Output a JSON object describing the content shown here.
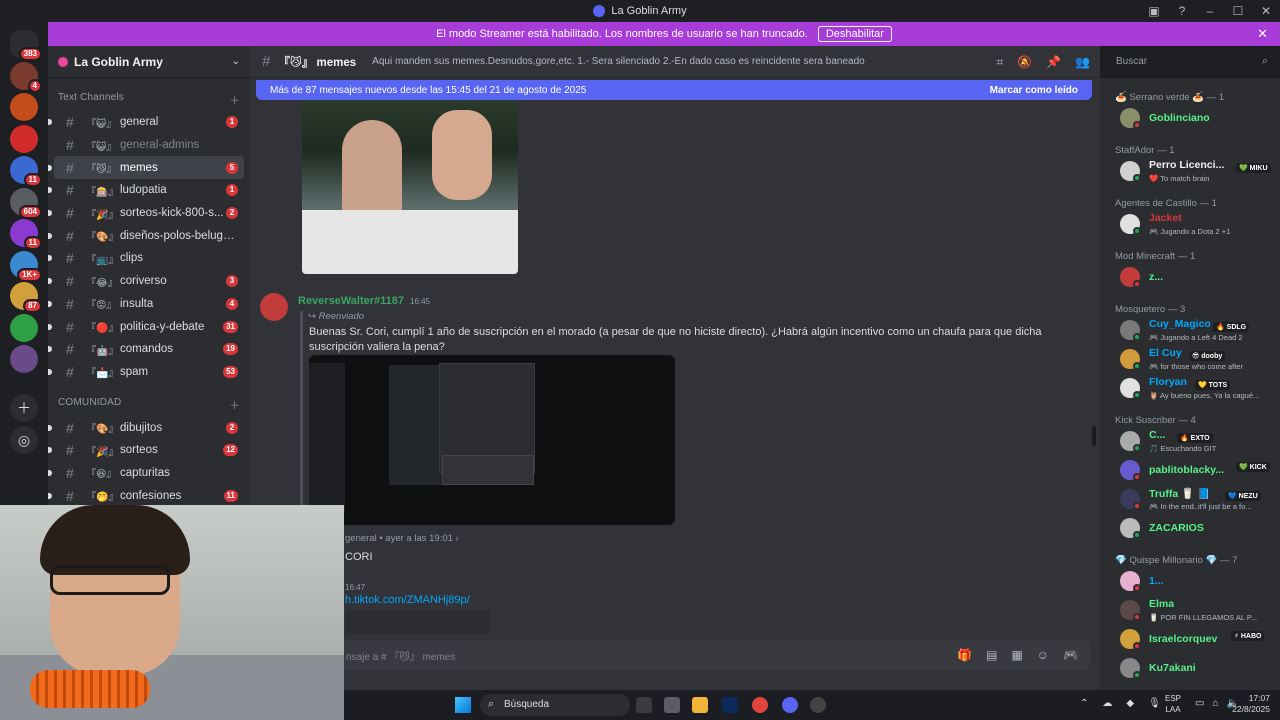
{
  "window": {
    "title": "La Goblin Army"
  },
  "banner": {
    "text": "El modo Streamer está habilitado. Los nombres de usuario se han truncado.",
    "button": "Deshabilitar"
  },
  "servers": [
    {
      "badge": "383",
      "color": "#2b2d31"
    },
    {
      "badge": "4",
      "color": "#7a3b2e"
    },
    {
      "badge": "",
      "color": "#c44b1b"
    },
    {
      "badge": "",
      "color": "#d12b2b"
    },
    {
      "badge": "11",
      "color": "#3a6ad1"
    },
    {
      "badge": "604",
      "color": "#5a5d63"
    },
    {
      "badge": "11",
      "color": "#8a3ad1"
    },
    {
      "badge": "1K+",
      "color": "#3a8ad1"
    },
    {
      "badge": "87",
      "color": "#d1a03a"
    },
    {
      "badge": "",
      "color": "#2ea043"
    },
    {
      "badge": "",
      "color": "#6a4a8a"
    }
  ],
  "guild": {
    "name": "La Goblin Army"
  },
  "categories": {
    "text": "Text Channels",
    "community": "COMUNIDAD"
  },
  "channels": [
    {
      "deco": "『😺』",
      "name": "general",
      "count": "1",
      "state": ""
    },
    {
      "deco": "『😺』",
      "name": "general-admins",
      "count": "",
      "state": "muted"
    },
    {
      "deco": "『😼』",
      "name": "memes",
      "count": "5",
      "state": "active"
    },
    {
      "deco": "『🎰』",
      "name": "ludopatia",
      "count": "1",
      "state": ""
    },
    {
      "deco": "『🎉』",
      "name": "sorteos-kick-800-s...",
      "count": "2",
      "state": ""
    },
    {
      "deco": "『🎨』",
      "name": "diseños-polos-beluga-ar...",
      "count": "",
      "state": ""
    },
    {
      "deco": "『📺』",
      "name": "clips",
      "count": "",
      "state": ""
    },
    {
      "deco": "『😂』",
      "name": "coriverso",
      "count": "3",
      "state": ""
    },
    {
      "deco": "『😡』",
      "name": "insulta",
      "count": "4",
      "state": ""
    },
    {
      "deco": "『🔴』",
      "name": "politica-y-debate",
      "count": "31",
      "state": ""
    },
    {
      "deco": "『🤖』",
      "name": "comandos",
      "count": "19",
      "state": ""
    },
    {
      "deco": "『📩』",
      "name": "spam",
      "count": "53",
      "state": ""
    }
  ],
  "community_channels": [
    {
      "deco": "『🎨』",
      "name": "dibujitos",
      "count": "2"
    },
    {
      "deco": "『🎉』",
      "name": "sorteos",
      "count": "12"
    },
    {
      "deco": "『😆』",
      "name": "capturitas",
      "count": ""
    },
    {
      "deco": "『🤭』",
      "name": "confesiones",
      "count": "11"
    }
  ],
  "header": {
    "channel": "『😼』 memes",
    "topic": "Aqui manden sus memes.Desnudos,gore,etc. 1.- Sera silenciado 2.-En dado caso es reincidente sera baneado",
    "search_placeholder": "Buscar"
  },
  "new_bar": {
    "text": "Más de 87 mensajes nuevos desde las 15:45 del 21 de agosto de 2025",
    "action": "Marcar como leído"
  },
  "message": {
    "author": "ReverseWalter#1187",
    "time": "16:45",
    "forwarded": "Reenviado",
    "text": "Buenas Sr. Cori, cumplí 1 año de suscripción en el morado (a pesar de que no hiciste directo). ¿Habrá algún incentivo como un chaufa para que dicha suscripción valiera la pena?",
    "source_meta": "general  •  ayer a las 19:01  ›"
  },
  "message2": {
    "text": "CORI",
    "time": "16:47",
    "link": "h.tiktok.com/ZMANHj89p/"
  },
  "composer": {
    "placeholder": "nsaje a # 『😼』 memes"
  },
  "members": {
    "groups": [
      {
        "title": "🍝 Serrano verde 🍝 — 1",
        "members": [
          {
            "name": "Goblinciano",
            "color": "#57f287",
            "tag": "",
            "activity": "",
            "status": "#da373c",
            "avatar": "#8a8f6a"
          }
        ]
      },
      {
        "title": "StaffAdor — 1",
        "members": [
          {
            "name": "Perro Licenci...",
            "color": "#f2f3f5",
            "tag": "💚 MIKU",
            "activity": "❤️ To match brain",
            "status": "#23a55a",
            "avatar": "#d0d0d0"
          }
        ]
      },
      {
        "title": "Agentes de Castillo — 1",
        "members": [
          {
            "name": "Jacket",
            "color": "#da373c",
            "tag": "",
            "activity": "🎮 Jugando a Dota 2 +1",
            "status": "#23a55a",
            "avatar": "#e0e0e0"
          }
        ]
      },
      {
        "title": "Mod Minecraft — 1",
        "members": [
          {
            "name": "z...",
            "color": "#57f287",
            "tag": "",
            "activity": "",
            "status": "#da373c",
            "avatar": "#c23c3c"
          }
        ]
      },
      {
        "title": "Mosquetero — 3",
        "members": [
          {
            "name": "Cuy_Magico",
            "color": "#00a8fc",
            "tag": "🔥 SDLG",
            "activity": "🎮 Jugando a Left 4 Dead 2",
            "status": "#23a55a",
            "avatar": "#7a7a7a"
          },
          {
            "name": "El Cuy",
            "color": "#00a8fc",
            "tag": "😎 dooby",
            "activity": "🎮 for those who come after",
            "status": "#23a55a",
            "avatar": "#d19a3a"
          },
          {
            "name": "Floryan",
            "color": "#00a8fc",
            "tag": "💛 TOTS",
            "activity": "🦉 Ay bueno pues, Ya la cagué...",
            "status": "#23a55a",
            "avatar": "#e0e0e0"
          }
        ]
      },
      {
        "title": "Kick Suscriber — 4",
        "members": [
          {
            "name": "C...",
            "color": "#57f287",
            "tag": "🔥 EXTO",
            "activity": "🎵 Escuchando GIT",
            "status": "#23a55a",
            "avatar": "#aaaaaa"
          },
          {
            "name": "pablitoblacky...",
            "color": "#57f287",
            "tag": "💚 KICK",
            "activity": "",
            "status": "#da373c",
            "avatar": "#6a5ad1"
          },
          {
            "name": "Truffa 🥛 📘",
            "color": "#57f287",
            "tag": "💙 NEZU",
            "activity": "🎮 In the end..it'll just be a fo...",
            "status": "#da373c",
            "avatar": "#3a3a5a"
          },
          {
            "name": "ZACARIOS",
            "color": "#57f287",
            "tag": "",
            "activity": "",
            "status": "#23a55a",
            "avatar": "#bbbbbb"
          }
        ]
      },
      {
        "title": "💎 Quispe Millonario 💎 — 7",
        "members": [
          {
            "name": "1...",
            "color": "#00a8fc",
            "tag": "",
            "activity": "",
            "status": "#da373c",
            "avatar": "#e8b0d0"
          },
          {
            "name": "Elma",
            "color": "#57f287",
            "tag": "",
            "activity": "🥛 POR FIN LLEGAMOS AL P...",
            "status": "#da373c",
            "avatar": "#5a4a4a"
          },
          {
            "name": "Israelcorquev",
            "color": "#57f287",
            "tag": "⚡ HABO",
            "activity": "",
            "status": "#da373c",
            "avatar": "#d1a03a"
          },
          {
            "name": "Ku7akani",
            "color": "#57f287",
            "tag": "",
            "activity": "",
            "status": "#23a55a",
            "avatar": "#888888"
          }
        ]
      }
    ]
  },
  "taskbar": {
    "search": "Búsqueda",
    "lang1": "ESP",
    "lang2": "LAA",
    "time": "17:07",
    "date": "22/8/2025"
  }
}
